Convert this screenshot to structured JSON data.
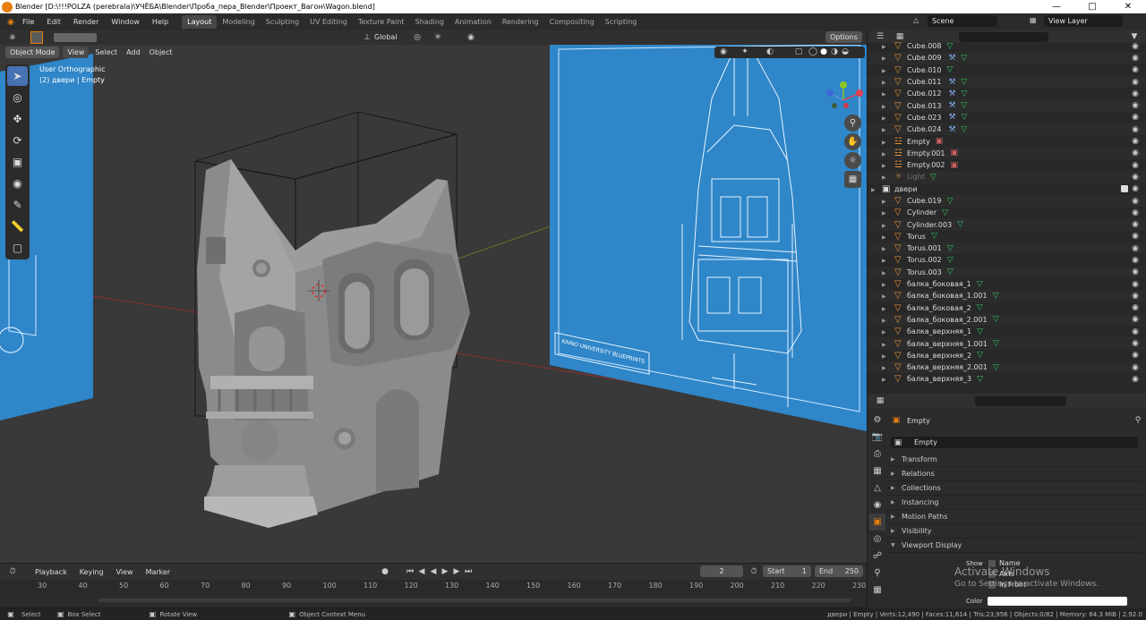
{
  "window": {
    "title": "Blender [D:\\!!!POLZA (perebrala)\\УЧЁБА\\Blender\\Проба_пера_Blender\\Проект_Вагон\\Wagon.blend]"
  },
  "menu": [
    "File",
    "Edit",
    "Render",
    "Window",
    "Help"
  ],
  "workspaces": [
    "Layout",
    "Modeling",
    "Sculpting",
    "UV Editing",
    "Texture Paint",
    "Shading",
    "Animation",
    "Rendering",
    "Compositing",
    "Scripting"
  ],
  "active_workspace": "Layout",
  "scene": {
    "name": "Scene",
    "view_layer": "View Layer"
  },
  "header3d": {
    "transform": "Global",
    "options": "Options"
  },
  "header3d_menu": {
    "mode": "Object Mode",
    "items": [
      "View",
      "Select",
      "Add",
      "Object"
    ]
  },
  "viewport": {
    "view_name": "User Orthographic",
    "context": "(2) двери | Empty",
    "blueprint_text": "KAINO UNIVERSITY BLUEPRINTS"
  },
  "outliner": {
    "rows": [
      {
        "name": "Cube.008",
        "type": "mesh",
        "indent": 2,
        "mod": false
      },
      {
        "name": "Cube.009",
        "type": "mesh",
        "indent": 2,
        "mod": true
      },
      {
        "name": "Cube.010",
        "type": "mesh",
        "indent": 2,
        "mod": false
      },
      {
        "name": "Cube.011",
        "type": "mesh",
        "indent": 2,
        "mod": true
      },
      {
        "name": "Cube.012",
        "type": "mesh",
        "indent": 2,
        "mod": true
      },
      {
        "name": "Cube.013",
        "type": "mesh",
        "indent": 2,
        "mod": true
      },
      {
        "name": "Cube.023",
        "type": "mesh",
        "indent": 2,
        "mod": true
      },
      {
        "name": "Cube.024",
        "type": "mesh",
        "indent": 2,
        "mod": true
      },
      {
        "name": "Empty",
        "type": "empty",
        "indent": 2,
        "mod": false
      },
      {
        "name": "Empty.001",
        "type": "empty",
        "indent": 2,
        "mod": false
      },
      {
        "name": "Empty.002",
        "type": "empty",
        "indent": 2,
        "mod": false
      },
      {
        "name": "Light",
        "type": "light",
        "indent": 2,
        "mod": false
      },
      {
        "name": "двери",
        "type": "collection",
        "indent": 1,
        "mod": false
      },
      {
        "name": "Cube.019",
        "type": "mesh",
        "indent": 2,
        "mod": false
      },
      {
        "name": "Cylinder",
        "type": "mesh",
        "indent": 2,
        "mod": false
      },
      {
        "name": "Cylinder.003",
        "type": "mesh",
        "indent": 2,
        "mod": false
      },
      {
        "name": "Torus",
        "type": "mesh",
        "indent": 2,
        "mod": false
      },
      {
        "name": "Torus.001",
        "type": "mesh",
        "indent": 2,
        "mod": false
      },
      {
        "name": "Torus.002",
        "type": "mesh",
        "indent": 2,
        "mod": false
      },
      {
        "name": "Torus.003",
        "type": "mesh",
        "indent": 2,
        "mod": false
      },
      {
        "name": "балка_боковая_1",
        "type": "mesh",
        "indent": 2,
        "mod": false
      },
      {
        "name": "балка_боковая_1.001",
        "type": "mesh",
        "indent": 2,
        "mod": false
      },
      {
        "name": "балка_боковая_2",
        "type": "mesh",
        "indent": 2,
        "mod": false
      },
      {
        "name": "балка_боковая_2.001",
        "type": "mesh",
        "indent": 2,
        "mod": false
      },
      {
        "name": "балка_верхняя_1",
        "type": "mesh",
        "indent": 2,
        "mod": false
      },
      {
        "name": "балка_верхняя_1.001",
        "type": "mesh",
        "indent": 2,
        "mod": false
      },
      {
        "name": "балка_верхняя_2",
        "type": "mesh",
        "indent": 2,
        "mod": false
      },
      {
        "name": "балка_верхняя_2.001",
        "type": "mesh",
        "indent": 2,
        "mod": false
      },
      {
        "name": "балка_верхняя_3",
        "type": "mesh",
        "indent": 2,
        "mod": false
      }
    ]
  },
  "properties": {
    "object_name": "Empty",
    "data_name": "Empty",
    "panels": [
      "Transform",
      "Relations",
      "Collections",
      "Instancing",
      "Motion Paths",
      "Visibility",
      "Viewport Display"
    ],
    "show_label": "Show",
    "checks": [
      "Name",
      "Axis",
      "In Front"
    ],
    "color_label": "Color"
  },
  "watermark": {
    "line1": "Activate Windows",
    "line2": "Go to Settings to activate Windows."
  },
  "timeline": {
    "menus": [
      "Playback",
      "Keying",
      "View",
      "Marker"
    ],
    "current_frame": "2",
    "start_label": "Start",
    "start": "1",
    "end_label": "End",
    "end": "250",
    "ticks": [
      "30",
      "40",
      "50",
      "60",
      "70",
      "80",
      "90",
      "100",
      "110",
      "120",
      "130",
      "140",
      "150",
      "160",
      "170",
      "180",
      "190",
      "200",
      "210",
      "220",
      "230"
    ]
  },
  "status": {
    "select": "Select",
    "box_select": "Box Select",
    "rotate": "Rotate View",
    "context_menu": "Object Context Menu",
    "stats": "двери | Empty | Verts:12,490 | Faces:11,614 | Tris:23,956 | Objects:0/82 | Memory: 64.3 MiB | 2.92.0"
  },
  "colors": {
    "accent": "#4772b3",
    "blueprint": "#2f86c8",
    "mesh_icon": "#e4903e",
    "modifier": "#2ec45e"
  }
}
